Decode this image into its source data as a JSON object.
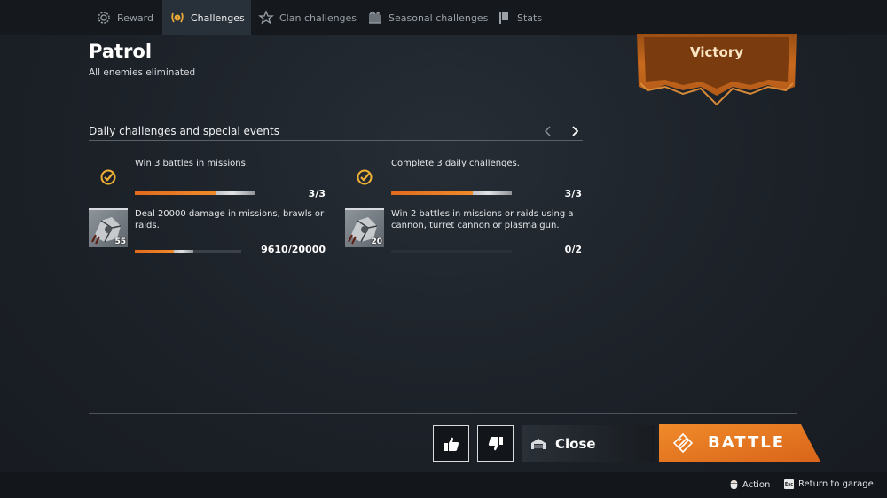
{
  "tabs": [
    {
      "label": "Reward",
      "icon": "gear-reward-icon",
      "active": false
    },
    {
      "label": "Challenges",
      "icon": "laurel-medal-icon",
      "active": true
    },
    {
      "label": "Clan challenges",
      "icon": "clan-badge-icon",
      "active": false
    },
    {
      "label": "Seasonal challenges",
      "icon": "seasonal-icon",
      "active": false
    },
    {
      "label": "Stats",
      "icon": "stats-flag-icon",
      "active": false
    }
  ],
  "battle": {
    "title": "Patrol",
    "subtitle": "All enemies eliminated",
    "result": "Victory"
  },
  "section": {
    "title": "Daily challenges and special events"
  },
  "challenges": [
    {
      "description": "Win 3 battles in missions.",
      "progress": "3/3",
      "completed": true,
      "fraction": 1.0
    },
    {
      "description": "Complete 3 daily challenges.",
      "progress": "3/3",
      "completed": true,
      "fraction": 1.0
    },
    {
      "description": "Deal 20000 damage in missions, brawls or raids.",
      "progress": "9610/20000",
      "completed": false,
      "fraction": 0.48,
      "level": "55",
      "icon": "weapon-part-icon"
    },
    {
      "description": "Win 2 battles in missions or raids using a cannon, turret cannon or plasma gun.",
      "progress": "0/2",
      "completed": false,
      "fraction": 0.0,
      "level": "20",
      "icon": "weapon-part-icon"
    }
  ],
  "buttons": {
    "close": "Close",
    "battle": "BATTLE"
  },
  "footer": {
    "action": "Action",
    "return": "Return to garage",
    "esc_key": "Esc"
  },
  "colors": {
    "accent_orange": "#e8731f",
    "check_gold": "#f0b135",
    "banner_orange": "#c9661c"
  }
}
